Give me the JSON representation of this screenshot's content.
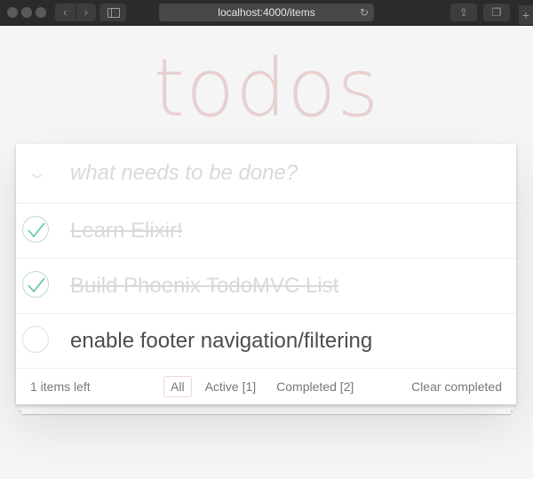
{
  "browser": {
    "url": "localhost:4000/items",
    "back_icon": "chevron-left-icon",
    "forward_icon": "chevron-right-icon",
    "reload_icon": "reload-icon",
    "share_icon": "share-icon",
    "tabs_icon": "tabs-icon",
    "new_tab_icon": "plus-icon",
    "new_tab_label": "+"
  },
  "app": {
    "title": "todos",
    "new_todo_placeholder": "what needs to be done?",
    "new_todo_value": "",
    "toggle_all_icon": "chevron-down-icon"
  },
  "todos": [
    {
      "label": "Learn Elixir!",
      "completed": true
    },
    {
      "label": "Build Phoenix TodoMVC List",
      "completed": true
    },
    {
      "label": "enable footer navigation/filtering",
      "completed": false
    }
  ],
  "footer": {
    "count": "1 items left",
    "filters": [
      {
        "label": "All",
        "selected": true
      },
      {
        "label": "Active [1]",
        "selected": false
      },
      {
        "label": "Completed [2]",
        "selected": false
      }
    ],
    "clear_completed": "Clear completed"
  },
  "colors": {
    "title": "#efd5d5",
    "check_done": "#5dc2af",
    "background": "#f5f5f5"
  }
}
